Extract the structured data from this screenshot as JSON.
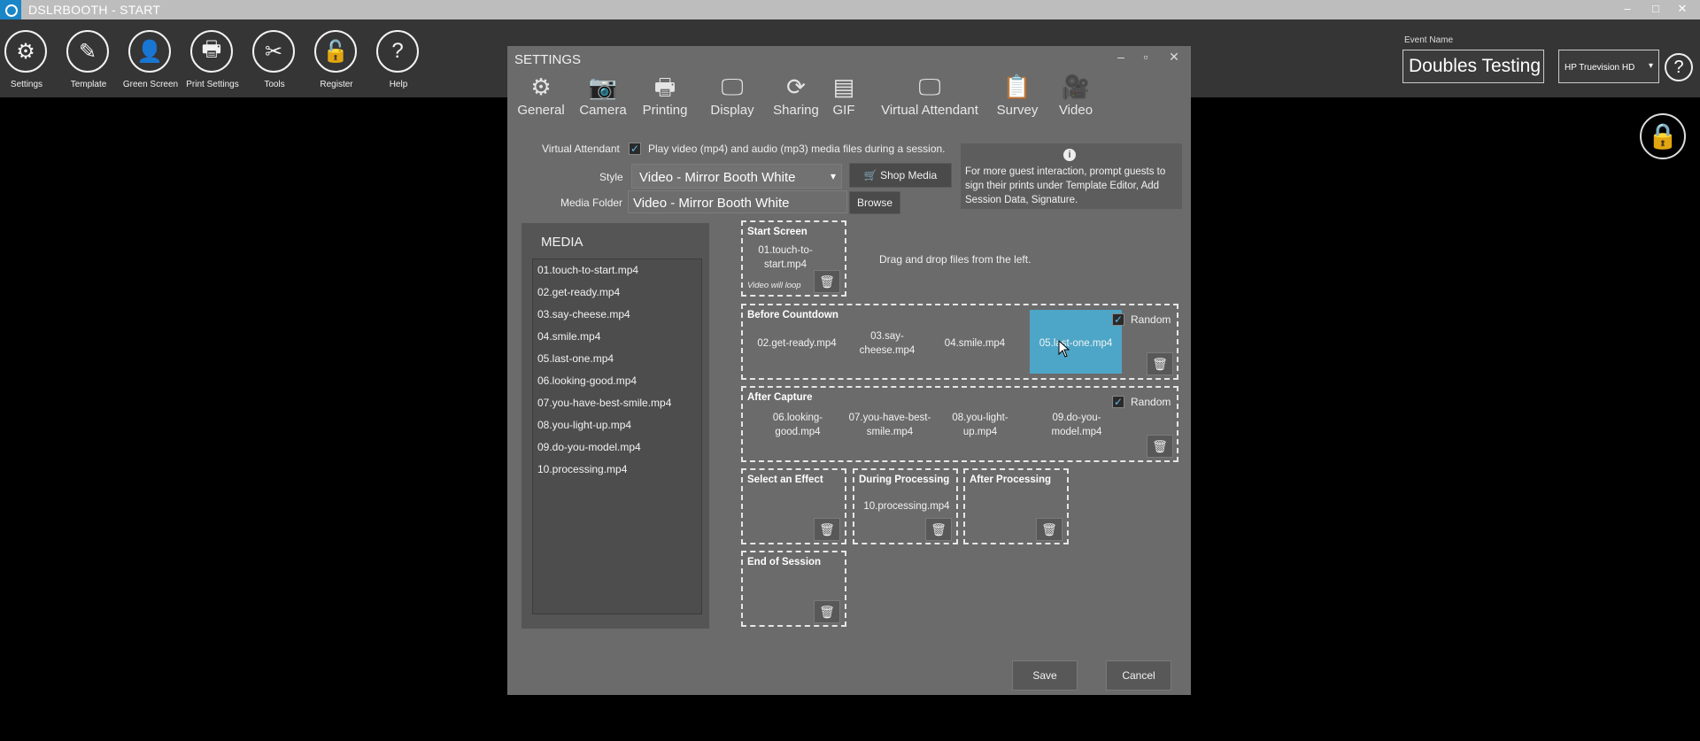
{
  "window": {
    "title": "DSLRBOOTH - START",
    "min": "–",
    "max": "□",
    "close": "✕"
  },
  "toolbar": {
    "items": [
      {
        "label": "Settings",
        "icon": "⚙"
      },
      {
        "label": "Template",
        "icon": "✎"
      },
      {
        "label": "Green Screen",
        "icon": "👤"
      },
      {
        "label": "Print Settings",
        "icon": "🖶"
      },
      {
        "label": "Tools",
        "icon": "✂"
      },
      {
        "label": "Register",
        "icon": "🔓"
      },
      {
        "label": "Help",
        "icon": "?"
      }
    ]
  },
  "event": {
    "label": "Event Name",
    "value": "Doubles Testing"
  },
  "camera": {
    "selected": "HP Truevision HD",
    "caret": "▾"
  },
  "help_icon": "?",
  "lock_icon": "🔒",
  "settings": {
    "title": "SETTINGS",
    "controls": {
      "min": "–",
      "max": "▫",
      "close": "✕"
    },
    "tabs": [
      {
        "label": "General",
        "icon": "⚙"
      },
      {
        "label": "Camera",
        "icon": "📷"
      },
      {
        "label": "Printing",
        "icon": "🖶"
      },
      {
        "label": "Display",
        "icon": "🖵"
      },
      {
        "label": "Sharing",
        "icon": "⟳"
      },
      {
        "label": "GIF",
        "icon": "▤"
      },
      {
        "label": "Virtual Attendant",
        "icon": "🖵"
      },
      {
        "label": "Survey",
        "icon": "📋"
      },
      {
        "label": "Video",
        "icon": "🎥"
      }
    ],
    "virtual_attendant": {
      "label": "Virtual Attendant",
      "checked": "✓",
      "description": "Play video (mp4) and audio (mp3) media files during a session."
    },
    "style": {
      "label": "Style",
      "value": "Video - Mirror Booth White",
      "caret": "▾"
    },
    "shop_media": {
      "label": "Shop Media",
      "icon": "🛒"
    },
    "media_folder": {
      "label": "Media Folder",
      "value": "Video - Mirror Booth White",
      "browse": "Browse"
    },
    "info": {
      "icon": "i",
      "text": "For more guest interaction, prompt guests to sign their prints under Template Editor, Add Session Data, Signature."
    },
    "media": {
      "title": "MEDIA",
      "files": [
        "01.touch-to-start.mp4",
        "02.get-ready.mp4",
        "03.say-cheese.mp4",
        "04.smile.mp4",
        "05.last-one.mp4",
        "06.looking-good.mp4",
        "07.you-have-best-smile.mp4",
        "08.you-light-up.mp4",
        "09.do-you-model.mp4",
        "10.processing.mp4"
      ]
    },
    "zones": {
      "start_screen": {
        "title": "Start Screen",
        "file": "01.touch-to-start.mp4",
        "note": "Video will loop"
      },
      "drag_hint": "Drag and drop files from the left.",
      "before_countdown": {
        "title": "Before Countdown",
        "random": "Random",
        "checked": "✓",
        "files": [
          "02.get-ready.mp4",
          "03.say-cheese.mp4",
          "04.smile.mp4",
          "05.last-one.mp4"
        ]
      },
      "after_capture": {
        "title": "After Capture",
        "random": "Random",
        "checked": "✓",
        "files": [
          "06.looking-good.mp4",
          "07.you-have-best-smile.mp4",
          "08.you-light-up.mp4",
          "09.do-you-model.mp4"
        ]
      },
      "select_effect": {
        "title": "Select an Effect"
      },
      "during_processing": {
        "title": "During Processing",
        "file": "10.processing.mp4"
      },
      "after_processing": {
        "title": "After Processing"
      },
      "end_of_session": {
        "title": "End of Session"
      },
      "trash_icon": "🗑"
    },
    "buttons": {
      "save": "Save",
      "cancel": "Cancel"
    }
  },
  "colors": {
    "highlight": "#4da6c8",
    "checkbox": "#5fb8e8",
    "dialog_bg": "#6b6b6b",
    "toolbar_bg": "#353535"
  }
}
